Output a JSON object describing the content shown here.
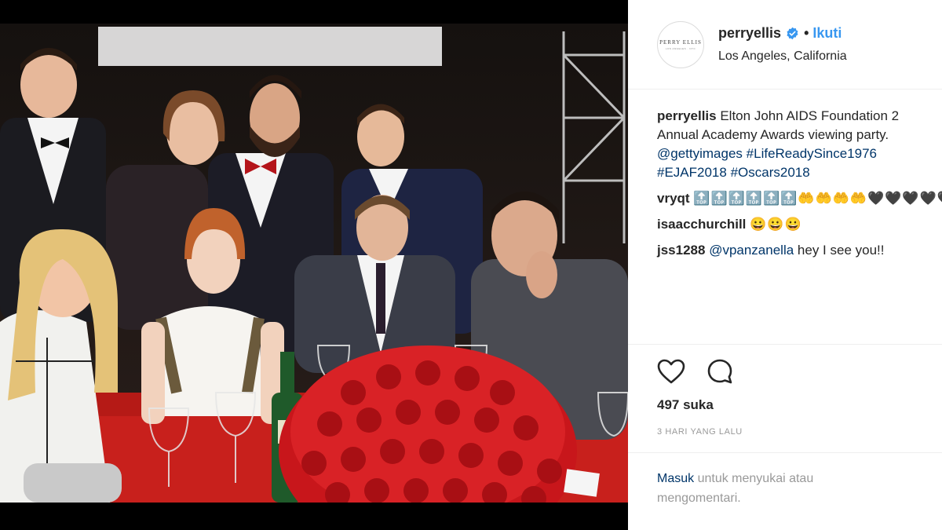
{
  "post": {
    "username": "perryellis",
    "follow_label": "Ikuti",
    "dot": "•",
    "location": "Los Angeles, California",
    "avatar_text": "PERRY ELLIS",
    "avatar_sub": "LOS ANGELES · NYC"
  },
  "caption": {
    "username": "perryellis",
    "line1": "Elton John AIDS Foundation 2",
    "line2": "Annual Academy Awards viewing party.",
    "mention": "@gettyimages",
    "hashtag1": "#LifeReadySince1976",
    "hashtag2": "#EJAF2018",
    "hashtag3": "#Oscars2018"
  },
  "comments": [
    {
      "user": "vryqt",
      "text": "🔝🔝🔝🔝🔝🔝🤲🤲🤲🤲🖤🖤🖤🖤🖤"
    },
    {
      "user": "isaacchurchill",
      "text": "😀😀😀"
    },
    {
      "user": "jss1288",
      "mention": "@vpanzanella",
      "text": "hey I see you!!"
    }
  ],
  "stats": {
    "likes": "497 suka",
    "time_ago": "3 HARI YANG LALU"
  },
  "login_prompt": {
    "link": "Masuk",
    "text": "untuk menyukai atau mengomentari."
  },
  "icons": {
    "like": "heart-icon",
    "comment": "comment-icon",
    "verified": "verified-badge-icon"
  },
  "colors": {
    "link": "#003569",
    "follow": "#3897f0",
    "text": "#262626",
    "muted": "#999999"
  }
}
